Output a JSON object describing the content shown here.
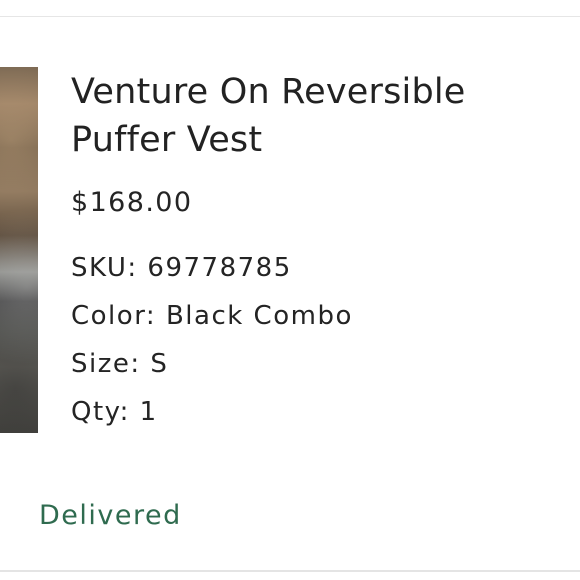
{
  "order_item": {
    "title": "Venture On Reversible Puffer Vest",
    "price": "$168.00",
    "sku": "SKU: 69778785",
    "color": "Color: Black Combo",
    "size": "Size: S",
    "qty": "Qty: 1",
    "status": "Delivered",
    "status_color": "#2f6b4f"
  }
}
